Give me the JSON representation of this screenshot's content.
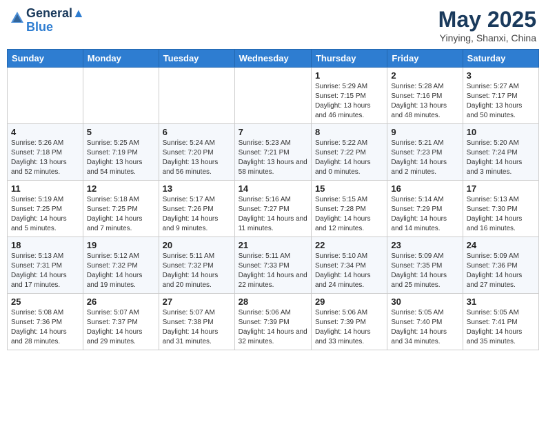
{
  "header": {
    "logo_line1": "General",
    "logo_line2": "Blue",
    "month_title": "May 2025",
    "location": "Yinying, Shanxi, China"
  },
  "weekdays": [
    "Sunday",
    "Monday",
    "Tuesday",
    "Wednesday",
    "Thursday",
    "Friday",
    "Saturday"
  ],
  "weeks": [
    [
      {
        "num": "",
        "info": ""
      },
      {
        "num": "",
        "info": ""
      },
      {
        "num": "",
        "info": ""
      },
      {
        "num": "",
        "info": ""
      },
      {
        "num": "1",
        "info": "Sunrise: 5:29 AM\nSunset: 7:15 PM\nDaylight: 13 hours\nand 46 minutes."
      },
      {
        "num": "2",
        "info": "Sunrise: 5:28 AM\nSunset: 7:16 PM\nDaylight: 13 hours\nand 48 minutes."
      },
      {
        "num": "3",
        "info": "Sunrise: 5:27 AM\nSunset: 7:17 PM\nDaylight: 13 hours\nand 50 minutes."
      }
    ],
    [
      {
        "num": "4",
        "info": "Sunrise: 5:26 AM\nSunset: 7:18 PM\nDaylight: 13 hours\nand 52 minutes."
      },
      {
        "num": "5",
        "info": "Sunrise: 5:25 AM\nSunset: 7:19 PM\nDaylight: 13 hours\nand 54 minutes."
      },
      {
        "num": "6",
        "info": "Sunrise: 5:24 AM\nSunset: 7:20 PM\nDaylight: 13 hours\nand 56 minutes."
      },
      {
        "num": "7",
        "info": "Sunrise: 5:23 AM\nSunset: 7:21 PM\nDaylight: 13 hours\nand 58 minutes."
      },
      {
        "num": "8",
        "info": "Sunrise: 5:22 AM\nSunset: 7:22 PM\nDaylight: 14 hours\nand 0 minutes."
      },
      {
        "num": "9",
        "info": "Sunrise: 5:21 AM\nSunset: 7:23 PM\nDaylight: 14 hours\nand 2 minutes."
      },
      {
        "num": "10",
        "info": "Sunrise: 5:20 AM\nSunset: 7:24 PM\nDaylight: 14 hours\nand 3 minutes."
      }
    ],
    [
      {
        "num": "11",
        "info": "Sunrise: 5:19 AM\nSunset: 7:25 PM\nDaylight: 14 hours\nand 5 minutes."
      },
      {
        "num": "12",
        "info": "Sunrise: 5:18 AM\nSunset: 7:25 PM\nDaylight: 14 hours\nand 7 minutes."
      },
      {
        "num": "13",
        "info": "Sunrise: 5:17 AM\nSunset: 7:26 PM\nDaylight: 14 hours\nand 9 minutes."
      },
      {
        "num": "14",
        "info": "Sunrise: 5:16 AM\nSunset: 7:27 PM\nDaylight: 14 hours\nand 11 minutes."
      },
      {
        "num": "15",
        "info": "Sunrise: 5:15 AM\nSunset: 7:28 PM\nDaylight: 14 hours\nand 12 minutes."
      },
      {
        "num": "16",
        "info": "Sunrise: 5:14 AM\nSunset: 7:29 PM\nDaylight: 14 hours\nand 14 minutes."
      },
      {
        "num": "17",
        "info": "Sunrise: 5:13 AM\nSunset: 7:30 PM\nDaylight: 14 hours\nand 16 minutes."
      }
    ],
    [
      {
        "num": "18",
        "info": "Sunrise: 5:13 AM\nSunset: 7:31 PM\nDaylight: 14 hours\nand 17 minutes."
      },
      {
        "num": "19",
        "info": "Sunrise: 5:12 AM\nSunset: 7:32 PM\nDaylight: 14 hours\nand 19 minutes."
      },
      {
        "num": "20",
        "info": "Sunrise: 5:11 AM\nSunset: 7:32 PM\nDaylight: 14 hours\nand 20 minutes."
      },
      {
        "num": "21",
        "info": "Sunrise: 5:11 AM\nSunset: 7:33 PM\nDaylight: 14 hours\nand 22 minutes."
      },
      {
        "num": "22",
        "info": "Sunrise: 5:10 AM\nSunset: 7:34 PM\nDaylight: 14 hours\nand 24 minutes."
      },
      {
        "num": "23",
        "info": "Sunrise: 5:09 AM\nSunset: 7:35 PM\nDaylight: 14 hours\nand 25 minutes."
      },
      {
        "num": "24",
        "info": "Sunrise: 5:09 AM\nSunset: 7:36 PM\nDaylight: 14 hours\nand 27 minutes."
      }
    ],
    [
      {
        "num": "25",
        "info": "Sunrise: 5:08 AM\nSunset: 7:36 PM\nDaylight: 14 hours\nand 28 minutes."
      },
      {
        "num": "26",
        "info": "Sunrise: 5:07 AM\nSunset: 7:37 PM\nDaylight: 14 hours\nand 29 minutes."
      },
      {
        "num": "27",
        "info": "Sunrise: 5:07 AM\nSunset: 7:38 PM\nDaylight: 14 hours\nand 31 minutes."
      },
      {
        "num": "28",
        "info": "Sunrise: 5:06 AM\nSunset: 7:39 PM\nDaylight: 14 hours\nand 32 minutes."
      },
      {
        "num": "29",
        "info": "Sunrise: 5:06 AM\nSunset: 7:39 PM\nDaylight: 14 hours\nand 33 minutes."
      },
      {
        "num": "30",
        "info": "Sunrise: 5:05 AM\nSunset: 7:40 PM\nDaylight: 14 hours\nand 34 minutes."
      },
      {
        "num": "31",
        "info": "Sunrise: 5:05 AM\nSunset: 7:41 PM\nDaylight: 14 hours\nand 35 minutes."
      }
    ]
  ]
}
